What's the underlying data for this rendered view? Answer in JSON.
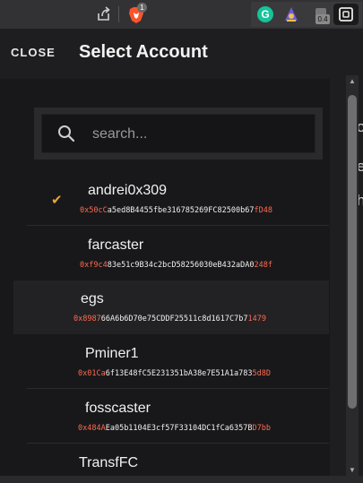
{
  "browser": {
    "brave_badge": "1",
    "grammarly_letter": "G",
    "extension_badge": "0.4",
    "icons": [
      "share-icon",
      "brave-lion-icon",
      "grammarly-icon",
      "wizard-icon",
      "extension-icon"
    ]
  },
  "header": {
    "close_label": "CLOSE",
    "title": "Select Account"
  },
  "search": {
    "placeholder": "search..."
  },
  "accounts": [
    {
      "name": "andrei0x309",
      "address_prefix": "0x50cC",
      "address_middle": "a5ed8B4455fbe316785269FC82500b67",
      "address_suffix": "fD48",
      "selected": true
    },
    {
      "name": "farcaster",
      "address_prefix": "0xf9c4",
      "address_middle": "83e51c9B34c2bcD58256030eB432aDA0",
      "address_suffix": "248f",
      "selected": false
    },
    {
      "name": "egs",
      "address_prefix": "0x8987",
      "address_middle": "66A6b6D70e75CDDF25511c8d1617C7b7",
      "address_suffix": "1479",
      "selected": false,
      "hovered": true
    },
    {
      "name": "Pminer1",
      "address_prefix": "0x01Ca",
      "address_middle": "6f13E48fC5E231351bA38e7E51A1a783",
      "address_suffix": "5d8D",
      "selected": false
    },
    {
      "name": "fosscaster",
      "address_prefix": "0x484A",
      "address_middle": "Ea05b1104E3cf57F33104DC1fCa6357B",
      "address_suffix": "D7bb",
      "selected": false
    },
    {
      "name": "TransfFC",
      "address_prefix": "",
      "address_middle": "",
      "address_suffix": "",
      "selected": false
    }
  ],
  "background_page": {
    "letters": [
      "o",
      "e",
      "h"
    ]
  },
  "colors": {
    "accent_check": "#e0a73a",
    "address_highlight": "#ff6a50",
    "panel_bg": "#18181a"
  }
}
